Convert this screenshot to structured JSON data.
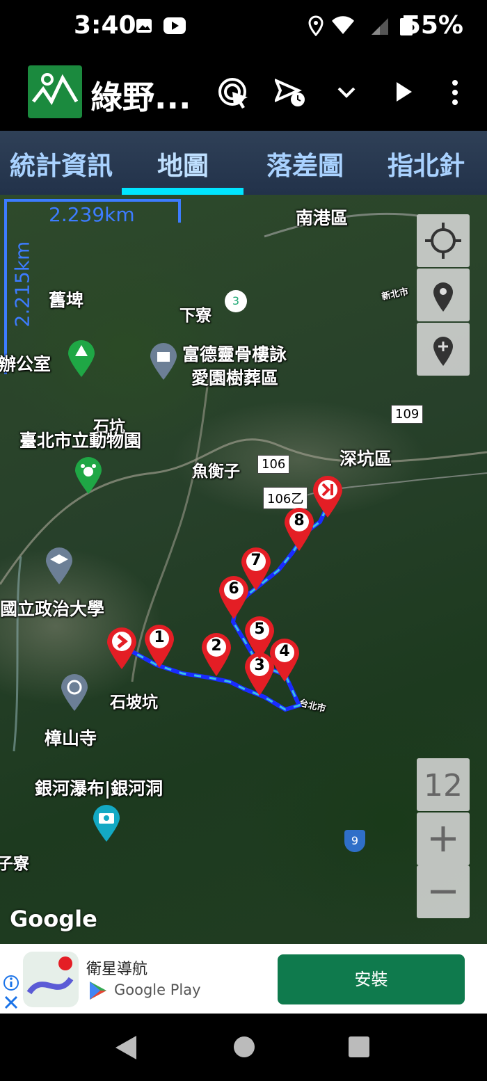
{
  "status_bar": {
    "time": "3:40",
    "battery": "55%"
  },
  "app": {
    "title": "綠野..."
  },
  "tabs": [
    {
      "label": "統計資訊",
      "active": false
    },
    {
      "label": "地圖",
      "active": true
    },
    {
      "label": "落差圖",
      "active": false
    },
    {
      "label": "指北針",
      "active": false
    }
  ],
  "map": {
    "scale_horizontal": "2.239km",
    "scale_vertical": "2.215km",
    "zoom_level": "12",
    "attribution": "Google",
    "place_labels": [
      "南港區",
      "舊埤",
      "下寮",
      "富德靈骨樓詠",
      "愛園樹葬區",
      "辦公室",
      "石坑",
      "臺北市立動物園",
      "魚衡子",
      "深坑區",
      "國立政治大學",
      "石坡坑",
      "樟山寺",
      "銀河瀑布|銀河洞",
      "子寮",
      "新北市",
      "台北市"
    ],
    "road_labels": [
      "109",
      "106",
      "106乙",
      "3",
      "9"
    ],
    "waypoints": [
      "1",
      "2",
      "3",
      "4",
      "5",
      "6",
      "7",
      "8"
    ]
  },
  "ad": {
    "app_name": "衛星導航",
    "store": "Google Play",
    "install_label": "安裝"
  },
  "colors": {
    "tab_indicator": "#00e5ff",
    "pin": "#e41e25",
    "track": "#1a2cff",
    "install": "#0f7a4d"
  }
}
